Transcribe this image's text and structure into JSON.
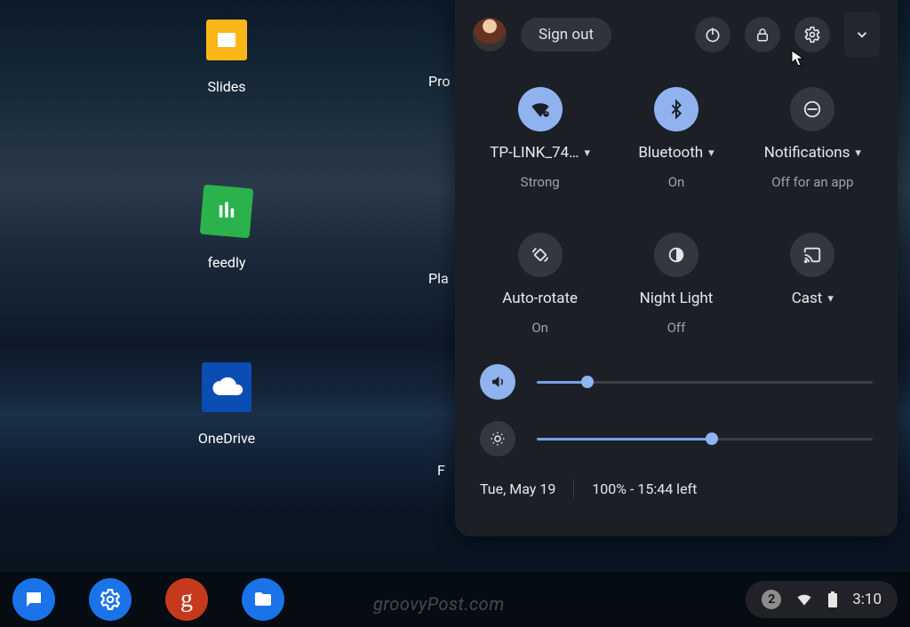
{
  "desktop": {
    "icons": [
      {
        "label": "Slides"
      },
      {
        "label": "feedly"
      },
      {
        "label": "OneDrive"
      }
    ],
    "partial_labels": [
      "Pro",
      "Pla",
      "F"
    ]
  },
  "quick_settings": {
    "signout_label": "Sign out",
    "tiles": [
      {
        "name": "wifi",
        "label": "TP-LINK_74…",
        "status": "Strong",
        "has_caret": true,
        "on": true
      },
      {
        "name": "bluetooth",
        "label": "Bluetooth",
        "status": "On",
        "has_caret": true,
        "on": true
      },
      {
        "name": "notifications",
        "label": "Notifications",
        "status": "Off for an app",
        "has_caret": true,
        "on": false
      },
      {
        "name": "autorotate",
        "label": "Auto-rotate",
        "status": "On",
        "has_caret": false,
        "on": false
      },
      {
        "name": "nightlight",
        "label": "Night Light",
        "status": "Off",
        "has_caret": false,
        "on": false
      },
      {
        "name": "cast",
        "label": "Cast",
        "status": "",
        "has_caret": true,
        "on": false
      }
    ],
    "volume_percent": 15,
    "brightness_percent": 52,
    "date": "Tue, May 19",
    "battery_text": "100% - 15:44 left"
  },
  "tray": {
    "notification_count": "2",
    "clock": "3:10"
  },
  "watermark": "groovyPost.com"
}
